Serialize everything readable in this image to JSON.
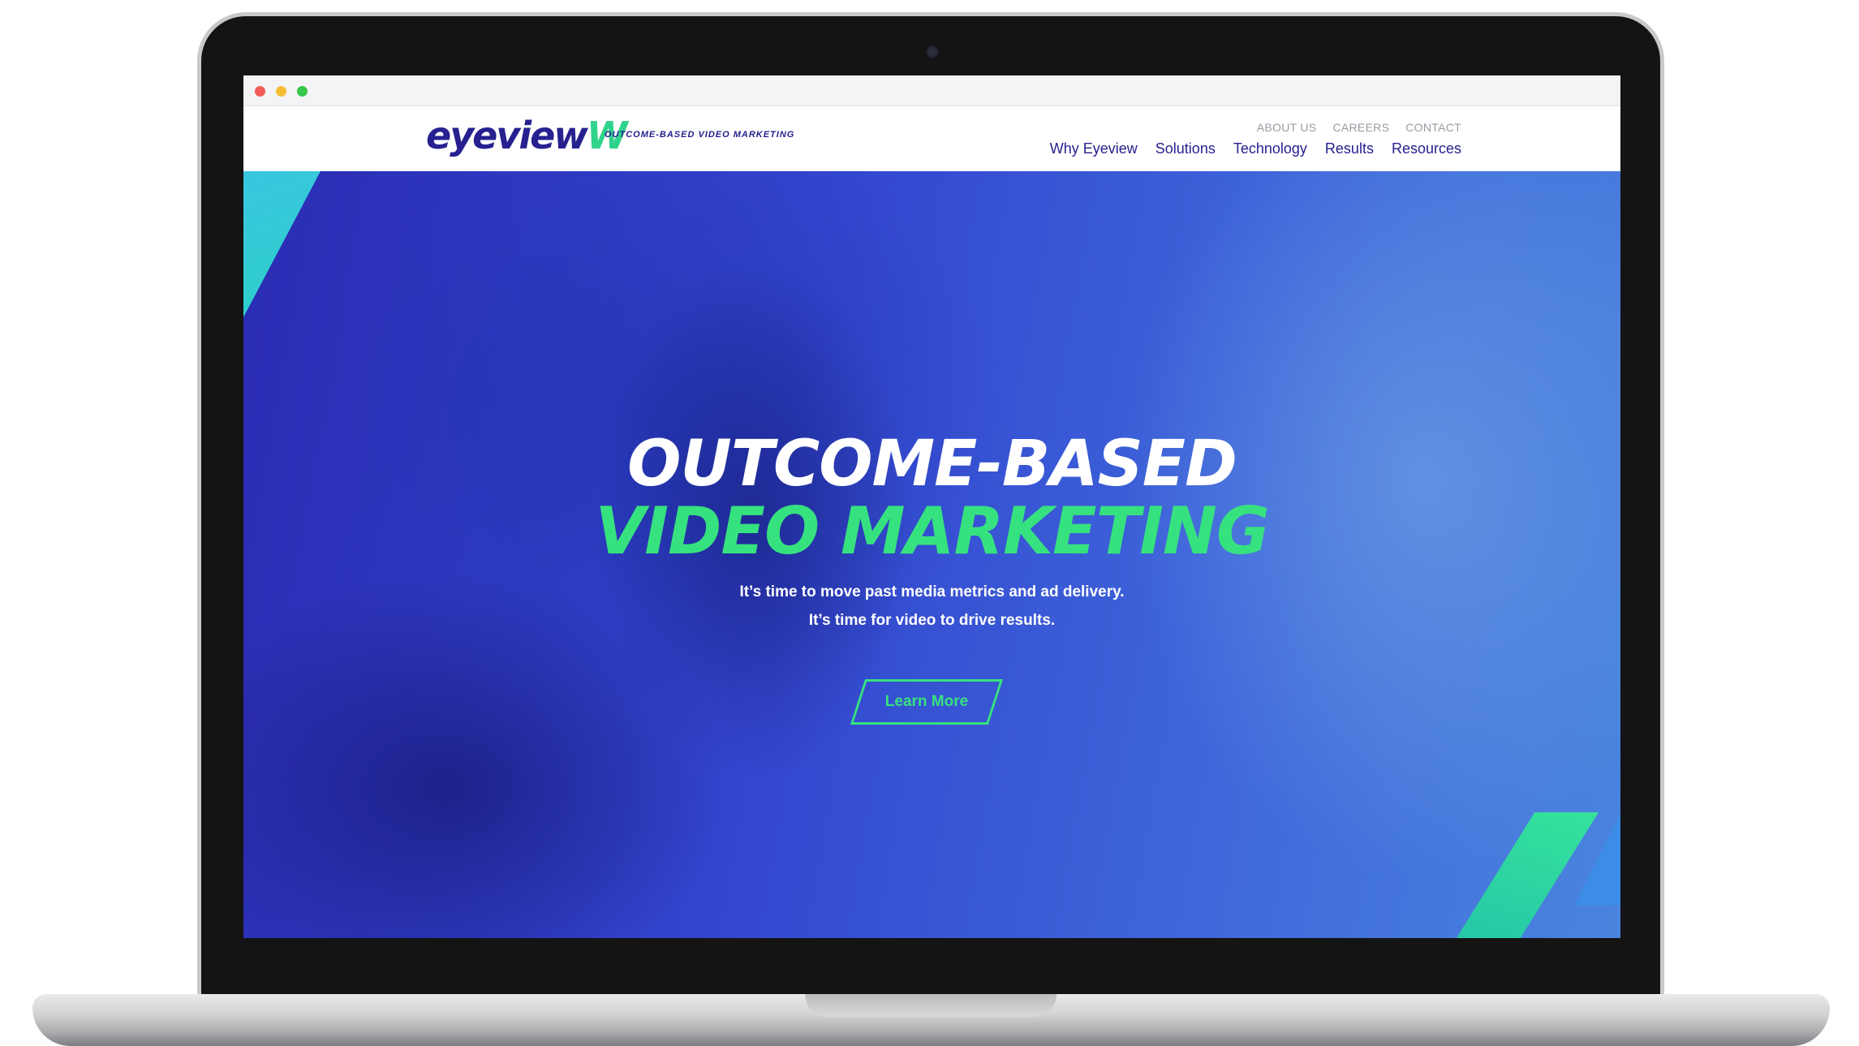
{
  "brand": {
    "logo_main": "eyeview",
    "logo_accent": "W",
    "tagline": "OUTCOME-BASED VIDEO MARKETING",
    "primary_color": "#26218f",
    "accent_color": "#36e27f"
  },
  "utility_nav": [
    "ABOUT US",
    "CAREERS",
    "CONTACT"
  ],
  "main_nav": [
    "Why Eyeview",
    "Solutions",
    "Technology",
    "Results",
    "Resources"
  ],
  "hero": {
    "title_line_1": "OUTCOME-BASED",
    "title_line_2": "VIDEO MARKETING",
    "subtitle_line_1": "It’s time to move past media metrics and ad delivery.",
    "subtitle_line_2": "It’s time for video to drive results.",
    "cta_label": "Learn More"
  },
  "window": {
    "controls": [
      "close",
      "minimize",
      "maximize"
    ]
  }
}
